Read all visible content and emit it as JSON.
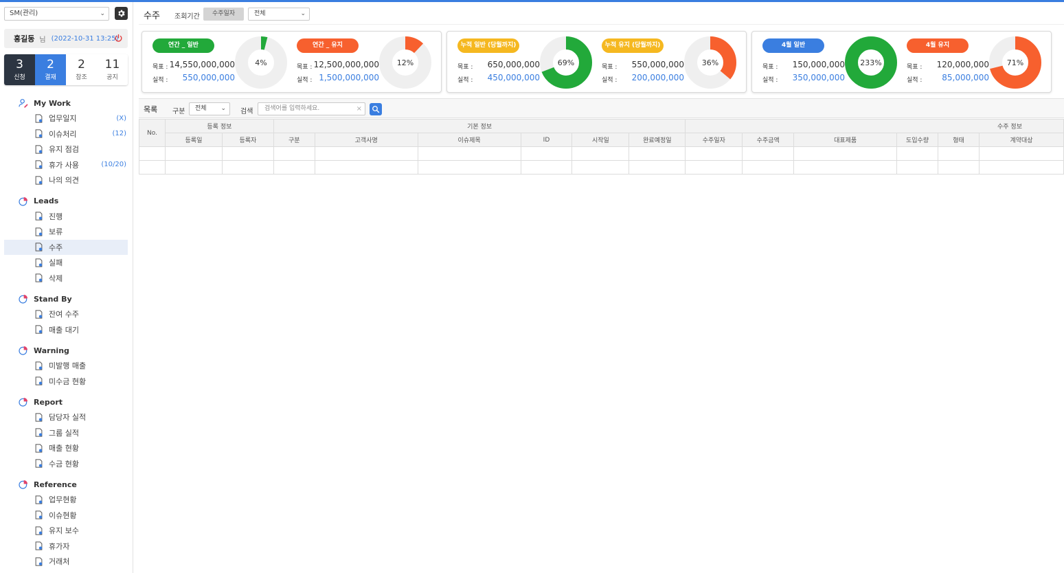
{
  "sidebar": {
    "role_select": "SM(관리)",
    "user": {
      "name": "홍길동",
      "suffix": "님",
      "datetime": "(2022-10-31 13:25)"
    },
    "counters": [
      {
        "num": "3",
        "label": "신청"
      },
      {
        "num": "2",
        "label": "결재"
      },
      {
        "num": "2",
        "label": "참조"
      },
      {
        "num": "11",
        "label": "공지"
      }
    ],
    "groups": [
      {
        "title": "My Work",
        "items": [
          {
            "label": "업무일지",
            "count": "(X)"
          },
          {
            "label": "이슈처리",
            "count": "(12)"
          },
          {
            "label": "유지 점검",
            "count": ""
          },
          {
            "label": "휴가 사용",
            "count": "(10/20)"
          },
          {
            "label": "나의 의견",
            "count": ""
          }
        ]
      },
      {
        "title": "Leads",
        "items": [
          {
            "label": "진행"
          },
          {
            "label": "보류"
          },
          {
            "label": "수주"
          },
          {
            "label": "실패"
          },
          {
            "label": "삭제"
          }
        ]
      },
      {
        "title": "Stand By",
        "items": [
          {
            "label": "잔여 수주"
          },
          {
            "label": "매출 대기"
          }
        ]
      },
      {
        "title": "Warning",
        "items": [
          {
            "label": "미발행 매출"
          },
          {
            "label": "미수금 현황"
          }
        ]
      },
      {
        "title": "Report",
        "items": [
          {
            "label": "담당자 실적"
          },
          {
            "label": "그룹 실적"
          },
          {
            "label": "매출 현황"
          },
          {
            "label": "수금 현황"
          }
        ]
      },
      {
        "title": "Reference",
        "items": [
          {
            "label": "업무현황"
          },
          {
            "label": "이슈현황"
          },
          {
            "label": "유지 보수"
          },
          {
            "label": "휴가자"
          },
          {
            "label": "거래처"
          }
        ]
      }
    ]
  },
  "header": {
    "title": "수주",
    "period_label": "조회기간",
    "date_type": "수주일자",
    "filter": "전체"
  },
  "kpis": [
    {
      "label": "연간 _ 일반",
      "target_label": "목표 :",
      "target": "14,550,000,000",
      "actual_label": "실적 :",
      "actual": "550,000,000",
      "percent": "4%",
      "ratio": 0.04,
      "pill_color": "#22a93a",
      "ring_color": "#22a93a"
    },
    {
      "label": "연간 _ 유지",
      "target_label": "목표 :",
      "target": "12,500,000,000",
      "actual_label": "실적 :",
      "actual": "1,500,000,000",
      "percent": "12%",
      "ratio": 0.12,
      "pill_color": "#f7602e",
      "ring_color": "#f7602e"
    },
    {
      "label": "누적 일반 (당월까지)",
      "target_label": "목표 :",
      "target": "650,000,000",
      "actual_label": "실적 :",
      "actual": "450,000,000",
      "percent": "69%",
      "ratio": 0.69,
      "pill_color": "#f5b820",
      "ring_color": "#22a93a"
    },
    {
      "label": "누적 유지 (당월까지)",
      "target_label": "목표 :",
      "target": "550,000,000",
      "actual_label": "실적 :",
      "actual": "200,000,000",
      "percent": "36%",
      "ratio": 0.36,
      "pill_color": "#f5b820",
      "ring_color": "#f7602e"
    },
    {
      "label": "4월 일반",
      "target_label": "목표 :",
      "target": "150,000,000",
      "actual_label": "실적 :",
      "actual": "350,000,000",
      "percent": "233%",
      "ratio": 1.0,
      "pill_color": "#3a7ee0",
      "ring_color": "#22a93a"
    },
    {
      "label": "4월 유지",
      "target_label": "목표 :",
      "target": "120,000,000",
      "actual_label": "실적 :",
      "actual": "85,000,000",
      "percent": "71%",
      "ratio": 0.71,
      "pill_color": "#f7602e",
      "ring_color": "#f7602e"
    }
  ],
  "list": {
    "title": "목록",
    "category_label": "구분",
    "category_value": "전체",
    "search_label": "검색",
    "search_placeholder": "검색어를 입력하세요.",
    "group_headers": {
      "no": "No.",
      "reg": "등록 정보",
      "basic": "기본 정보",
      "order": "수주 정보"
    },
    "columns": [
      "등록일",
      "등록자",
      "구분",
      "고객사명",
      "이슈제목",
      "ID",
      "시작일",
      "완료예정일",
      "수주일자",
      "수주금액",
      "대표제품",
      "도입수량",
      "형태",
      "계약대상"
    ]
  }
}
